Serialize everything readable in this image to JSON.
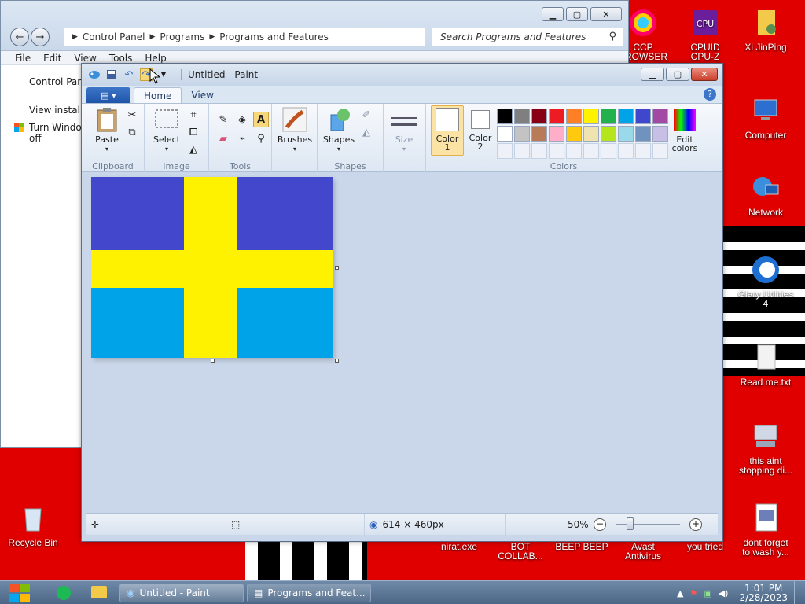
{
  "explorer": {
    "address": [
      "Control Panel",
      "Programs",
      "Programs and Features"
    ],
    "search_placeholder": "Search Programs and Features",
    "menu": [
      "File",
      "Edit",
      "View",
      "Tools",
      "Help"
    ],
    "sidebar": [
      "Control Panel",
      "View installe",
      "Turn Window",
      "off"
    ]
  },
  "paint": {
    "title": "Untitled - Paint",
    "tabs": [
      "Home",
      "View"
    ],
    "groups": {
      "clipboard": "Clipboard",
      "image": "Image",
      "tools": "Tools",
      "shapes": "Shapes",
      "colors": "Colors"
    },
    "buttons": {
      "paste": "Paste",
      "select": "Select",
      "brushes": "Brushes",
      "shapes": "Shapes",
      "size": "Size",
      "color1_a": "Color",
      "color1_b": "1",
      "color2_a": "Color",
      "color2_b": "2",
      "edit_colors_a": "Edit",
      "edit_colors_b": "colors"
    },
    "palette_row1": [
      "#000000",
      "#7f7f7f",
      "#880015",
      "#ed1c24",
      "#ff7f27",
      "#fff200",
      "#22b14c",
      "#00a2e8",
      "#3f48cc",
      "#a349a4"
    ],
    "palette_row2": [
      "#ffffff",
      "#c3c3c3",
      "#b97a57",
      "#ffaec9",
      "#ffc90e",
      "#efe4b0",
      "#b5e61d",
      "#99d9ea",
      "#7092be",
      "#c8bfe7"
    ],
    "flag_colors": {
      "top": "#4347cc",
      "bottom": "#00a2e8",
      "cross": "#fff200"
    },
    "status": {
      "size": "614 × 460px",
      "zoom": "50%"
    }
  },
  "desktop_icons": [
    {
      "name": "CCP",
      "sub": "BROWSER"
    },
    {
      "name": "CPUID",
      "sub": "CPU-Z"
    },
    {
      "name": "Xi JinPing",
      "sub": ""
    },
    {
      "name": "Computer",
      "sub": ""
    },
    {
      "name": "Network",
      "sub": ""
    },
    {
      "name": "Glary Utilities",
      "sub": "4"
    },
    {
      "name": "Read me.txt",
      "sub": ""
    },
    {
      "name": "this aint",
      "sub": "stopping di..."
    },
    {
      "name": "dont forget",
      "sub": "to wash y..."
    },
    {
      "name": "Recycle Bin",
      "sub": ""
    },
    {
      "name": "nirat.exe",
      "sub": ""
    },
    {
      "name": "BOT",
      "sub": "COLLAB..."
    },
    {
      "name": "BEEP BEEP",
      "sub": ""
    },
    {
      "name": "Avast",
      "sub": "Antivirus"
    },
    {
      "name": "you tried",
      "sub": ""
    }
  ],
  "taskbar": {
    "apps": [
      "Untitled - Paint",
      "Programs and Feat..."
    ],
    "time": "1:01 PM",
    "date": "2/28/2023"
  }
}
